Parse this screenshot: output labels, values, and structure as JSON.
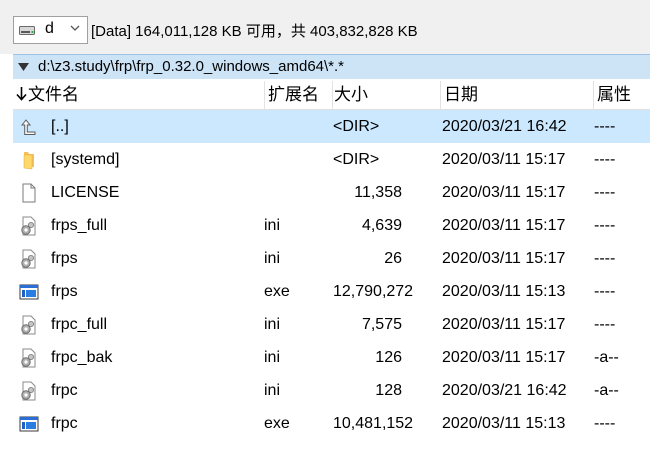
{
  "drivebar": {
    "drive_letter": "d",
    "drive_info": "[Data]  164,011,128 KB 可用，共 403,832,828 KB"
  },
  "pathbar": {
    "path": "d:\\z3.study\\frp\\frp_0.32.0_windows_amd64\\*.*"
  },
  "columns": {
    "name": "文件名",
    "ext": "扩展名",
    "size": "大小",
    "date": "日期",
    "attr": "属性"
  },
  "colors": {
    "selected_row": "#cce8ff",
    "path_bar": "#cde3f6"
  },
  "rows": [
    {
      "icon": "up-arrow-icon",
      "name": "[..]",
      "ext": "",
      "size": "<DIR>",
      "date": "2020/03/21 16:42",
      "attr": "----",
      "selected": true
    },
    {
      "icon": "folder-icon",
      "name": "[systemd]",
      "ext": "",
      "size": "<DIR>",
      "date": "2020/03/11 15:17",
      "attr": "----",
      "selected": false
    },
    {
      "icon": "blank-file-icon",
      "name": "LICENSE",
      "ext": "",
      "size": "11,358",
      "date": "2020/03/11 15:17",
      "attr": "----",
      "selected": false
    },
    {
      "icon": "settings-file-icon",
      "name": "frps_full",
      "ext": "ini",
      "size": "4,639",
      "date": "2020/03/11 15:17",
      "attr": "----",
      "selected": false
    },
    {
      "icon": "settings-file-icon",
      "name": "frps",
      "ext": "ini",
      "size": "26",
      "date": "2020/03/11 15:17",
      "attr": "----",
      "selected": false
    },
    {
      "icon": "executable-icon",
      "name": "frps",
      "ext": "exe",
      "size": "12,790,272",
      "date": "2020/03/11 15:13",
      "attr": "----",
      "selected": false
    },
    {
      "icon": "settings-file-icon",
      "name": "frpc_full",
      "ext": "ini",
      "size": "7,575",
      "date": "2020/03/11 15:17",
      "attr": "----",
      "selected": false
    },
    {
      "icon": "settings-file-icon",
      "name": "frpc_bak",
      "ext": "ini",
      "size": "126",
      "date": "2020/03/11 15:17",
      "attr": "-a--",
      "selected": false
    },
    {
      "icon": "settings-file-icon",
      "name": "frpc",
      "ext": "ini",
      "size": "128",
      "date": "2020/03/21 16:42",
      "attr": "-a--",
      "selected": false
    },
    {
      "icon": "executable-icon",
      "name": "frpc",
      "ext": "exe",
      "size": "10,481,152",
      "date": "2020/03/11 15:13",
      "attr": "----",
      "selected": false
    }
  ]
}
